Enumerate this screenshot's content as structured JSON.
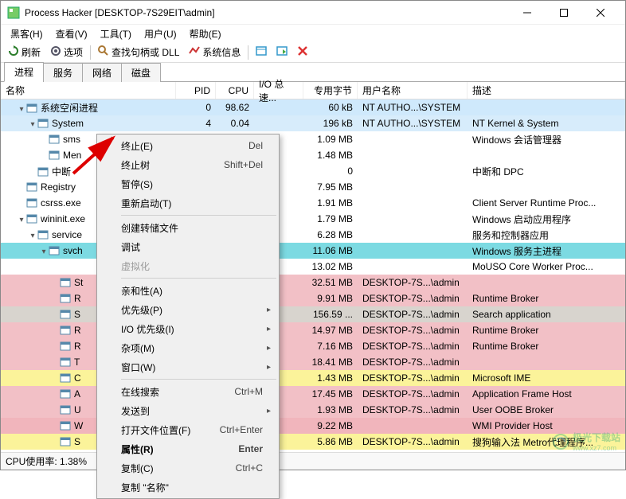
{
  "window": {
    "title": "Process Hacker [DESKTOP-7S29EIT\\admin]"
  },
  "menubar": [
    "黑客(H)",
    "查看(V)",
    "工具(T)",
    "用户(U)",
    "帮助(E)"
  ],
  "toolbar": {
    "refresh": "刷新",
    "options": "选项",
    "handles": "查找句柄或 DLL",
    "sysinfo": "系统信息"
  },
  "tabs": [
    "进程",
    "服务",
    "网络",
    "磁盘"
  ],
  "activeTab": 0,
  "columns": {
    "name": "名称",
    "pid": "PID",
    "cpu": "CPU",
    "io": "I/O 总速...",
    "priv": "专用字节",
    "user": "用户名称",
    "desc": "描述"
  },
  "rows": [
    {
      "bg": "bg-blue",
      "indent": 1,
      "toggle": "▾",
      "icon": "app",
      "name": "系统空闲进程",
      "pid": "0",
      "cpu": "98.62",
      "io": "",
      "priv": "60 kB",
      "user": "NT AUTHO...\\SYSTEM",
      "desc": ""
    },
    {
      "bg": "bg-lightblue",
      "indent": 2,
      "toggle": "▾",
      "icon": "app",
      "name": "System",
      "pid": "4",
      "cpu": "0.04",
      "io": "",
      "priv": "196 kB",
      "user": "NT AUTHO...\\SYSTEM",
      "desc": "NT Kernel & System"
    },
    {
      "bg": "bg-white",
      "indent": 3,
      "toggle": "",
      "icon": "app",
      "name": "sms",
      "pid": "",
      "cpu": "",
      "io": "",
      "priv": "1.09 MB",
      "user": "",
      "desc": "Windows 会话管理器"
    },
    {
      "bg": "bg-white",
      "indent": 3,
      "toggle": "",
      "icon": "app",
      "name": "Men",
      "pid": "",
      "cpu": "",
      "io": "",
      "priv": "1.48 MB",
      "user": "",
      "desc": ""
    },
    {
      "bg": "bg-white",
      "indent": 2,
      "toggle": "",
      "icon": "app",
      "name": "中断",
      "pid": "",
      "cpu": "",
      "io": "",
      "priv": "0",
      "user": "",
      "desc": "中断和 DPC"
    },
    {
      "bg": "bg-white",
      "indent": 1,
      "toggle": "",
      "icon": "app",
      "name": "Registry",
      "pid": "",
      "cpu": "",
      "io": "",
      "priv": "7.95 MB",
      "user": "",
      "desc": ""
    },
    {
      "bg": "bg-white",
      "indent": 1,
      "toggle": "",
      "icon": "app",
      "name": "csrss.exe",
      "pid": "",
      "cpu": "",
      "io": "",
      "priv": "1.91 MB",
      "user": "",
      "desc": "Client Server Runtime Proc..."
    },
    {
      "bg": "bg-white",
      "indent": 1,
      "toggle": "▾",
      "icon": "app",
      "name": "wininit.exe",
      "pid": "",
      "cpu": "",
      "io": "",
      "priv": "1.79 MB",
      "user": "",
      "desc": "Windows 启动应用程序"
    },
    {
      "bg": "bg-white",
      "indent": 2,
      "toggle": "▾",
      "icon": "app",
      "name": "service",
      "pid": "",
      "cpu": "",
      "io": "",
      "priv": "6.28 MB",
      "user": "",
      "desc": "服务和控制器应用"
    },
    {
      "bg": "bg-teal",
      "indent": 3,
      "toggle": "▾",
      "icon": "app",
      "name": "svch",
      "pid": "",
      "cpu": "",
      "io": "",
      "priv": "11.06 MB",
      "user": "",
      "desc": "Windows 服务主进程"
    },
    {
      "bg": "bg-white",
      "indent": 4,
      "toggle": "",
      "icon": "",
      "name": "",
      "pid": "",
      "cpu": "",
      "io": "",
      "priv": "13.02 MB",
      "user": "",
      "desc": "MoUSO Core Worker Proc..."
    },
    {
      "bg": "bg-pink",
      "indent": 4,
      "toggle": "",
      "icon": "app",
      "name": "St",
      "pid": "",
      "cpu": "",
      "io": "",
      "priv": "32.51 MB",
      "user": "DESKTOP-7S...\\admin",
      "desc": ""
    },
    {
      "bg": "bg-pink",
      "indent": 4,
      "toggle": "",
      "icon": "app",
      "name": "R",
      "pid": "",
      "cpu": "",
      "io": "",
      "priv": "9.91 MB",
      "user": "DESKTOP-7S...\\admin",
      "desc": "Runtime Broker"
    },
    {
      "bg": "bg-gray",
      "indent": 4,
      "toggle": "",
      "icon": "app",
      "name": "S",
      "pid": "",
      "cpu": "",
      "io": "",
      "priv": "156.59 ...",
      "user": "DESKTOP-7S...\\admin",
      "desc": "Search application"
    },
    {
      "bg": "bg-pink",
      "indent": 4,
      "toggle": "",
      "icon": "app",
      "name": "R",
      "pid": "",
      "cpu": "",
      "io": "",
      "priv": "14.97 MB",
      "user": "DESKTOP-7S...\\admin",
      "desc": "Runtime Broker"
    },
    {
      "bg": "bg-pink",
      "indent": 4,
      "toggle": "",
      "icon": "app",
      "name": "R",
      "pid": "",
      "cpu": "",
      "io": "",
      "priv": "7.16 MB",
      "user": "DESKTOP-7S...\\admin",
      "desc": "Runtime Broker"
    },
    {
      "bg": "bg-pink",
      "indent": 4,
      "toggle": "",
      "icon": "app",
      "name": "T",
      "pid": "",
      "cpu": "",
      "io": "",
      "priv": "18.41 MB",
      "user": "DESKTOP-7S...\\admin",
      "desc": ""
    },
    {
      "bg": "bg-yellow",
      "indent": 4,
      "toggle": "",
      "icon": "app",
      "name": "C",
      "pid": "",
      "cpu": "",
      "io": "",
      "priv": "1.43 MB",
      "user": "DESKTOP-7S...\\admin",
      "desc": "Microsoft IME"
    },
    {
      "bg": "bg-pink",
      "indent": 4,
      "toggle": "",
      "icon": "app",
      "name": "A",
      "pid": "",
      "cpu": "",
      "io": "",
      "priv": "17.45 MB",
      "user": "DESKTOP-7S...\\admin",
      "desc": "Application Frame Host"
    },
    {
      "bg": "bg-pink",
      "indent": 4,
      "toggle": "",
      "icon": "app",
      "name": "U",
      "pid": "",
      "cpu": "",
      "io": "",
      "priv": "1.93 MB",
      "user": "DESKTOP-7S...\\admin",
      "desc": "User OOBE Broker"
    },
    {
      "bg": "bg-pink2",
      "indent": 4,
      "toggle": "",
      "icon": "app",
      "name": "W",
      "pid": "",
      "cpu": "",
      "io": "",
      "priv": "9.22 MB",
      "user": "",
      "desc": "WMI Provider Host"
    },
    {
      "bg": "bg-yellow",
      "indent": 4,
      "toggle": "",
      "icon": "app",
      "name": "S",
      "pid": "",
      "cpu": "",
      "io": "",
      "priv": "5.86 MB",
      "user": "DESKTOP-7S...\\admin",
      "desc": "搜狗输入法 Metro代理程序..."
    }
  ],
  "context_menu": [
    {
      "type": "item",
      "label": "终止(E)",
      "hotkey": "Del"
    },
    {
      "type": "item",
      "label": "终止树",
      "hotkey": "Shift+Del"
    },
    {
      "type": "item",
      "label": "暂停(S)",
      "hotkey": ""
    },
    {
      "type": "item",
      "label": "重新启动(T)",
      "hotkey": ""
    },
    {
      "type": "sep"
    },
    {
      "type": "item",
      "label": "创建转储文件",
      "hotkey": ""
    },
    {
      "type": "item",
      "label": "调试",
      "hotkey": ""
    },
    {
      "type": "item",
      "label": "虚拟化",
      "hotkey": "",
      "disabled": true
    },
    {
      "type": "sep"
    },
    {
      "type": "item",
      "label": "亲和性(A)",
      "hotkey": ""
    },
    {
      "type": "sub",
      "label": "优先级(P)",
      "hotkey": ""
    },
    {
      "type": "sub",
      "label": "I/O 优先级(I)",
      "hotkey": ""
    },
    {
      "type": "sub",
      "label": "杂项(M)",
      "hotkey": ""
    },
    {
      "type": "sub",
      "label": "窗口(W)",
      "hotkey": ""
    },
    {
      "type": "sep"
    },
    {
      "type": "item",
      "label": "在线搜索",
      "hotkey": "Ctrl+M"
    },
    {
      "type": "sub",
      "label": "发送到",
      "hotkey": ""
    },
    {
      "type": "item",
      "label": "打开文件位置(F)",
      "hotkey": "Ctrl+Enter"
    },
    {
      "type": "item",
      "label": "属性(R)",
      "hotkey": "Enter",
      "bold": true
    },
    {
      "type": "item",
      "label": "复制(C)",
      "hotkey": "Ctrl+C"
    },
    {
      "type": "item",
      "label": "复制 \"名称\"",
      "hotkey": ""
    }
  ],
  "statusbar": {
    "cpu": "CPU使用率: 1.38%"
  },
  "watermark": {
    "text": "极光下载站",
    "url": "www.xz7.com"
  }
}
